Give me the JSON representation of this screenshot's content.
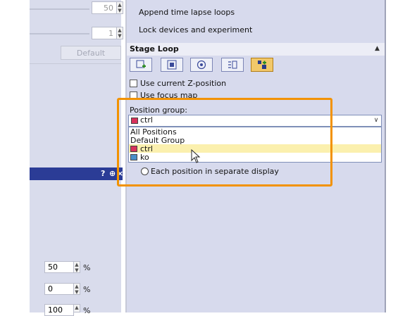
{
  "left_panel": {
    "spin1_value": "50",
    "spin2_value": "1",
    "default_label": "Default",
    "dock_icons": [
      "?",
      "⊕",
      "×"
    ],
    "pct_rows": [
      {
        "value": "50",
        "unit": "%"
      },
      {
        "value": "0",
        "unit": "%"
      },
      {
        "value": "100",
        "unit": "%"
      }
    ]
  },
  "right_panel": {
    "options": [
      "Append time lapse loops",
      "Lock devices and experiment"
    ],
    "stage_loop": {
      "title": "Stage Loop",
      "toolbar_icons": [
        "add-position-icon",
        "image-icon",
        "target-icon",
        "list-icon",
        "tiles-icon"
      ],
      "use_current_z": "Use current Z-position",
      "use_focus_map": "Use focus map",
      "position_group_label": "Position group:",
      "selected_group": "ctrl",
      "groups": [
        {
          "label": "All Positions",
          "color": ""
        },
        {
          "label": "Default Group",
          "color": ""
        },
        {
          "label": "ctrl",
          "color": "#d8315b"
        },
        {
          "label": "ko",
          "color": "#4a8fc9"
        }
      ],
      "separate_display": "Each position in separate display"
    }
  },
  "colors": {
    "accent_orange": "#f29200",
    "highlight": "#fbf0ae",
    "ctrl": "#d8315b",
    "ko": "#4a8fc9"
  }
}
